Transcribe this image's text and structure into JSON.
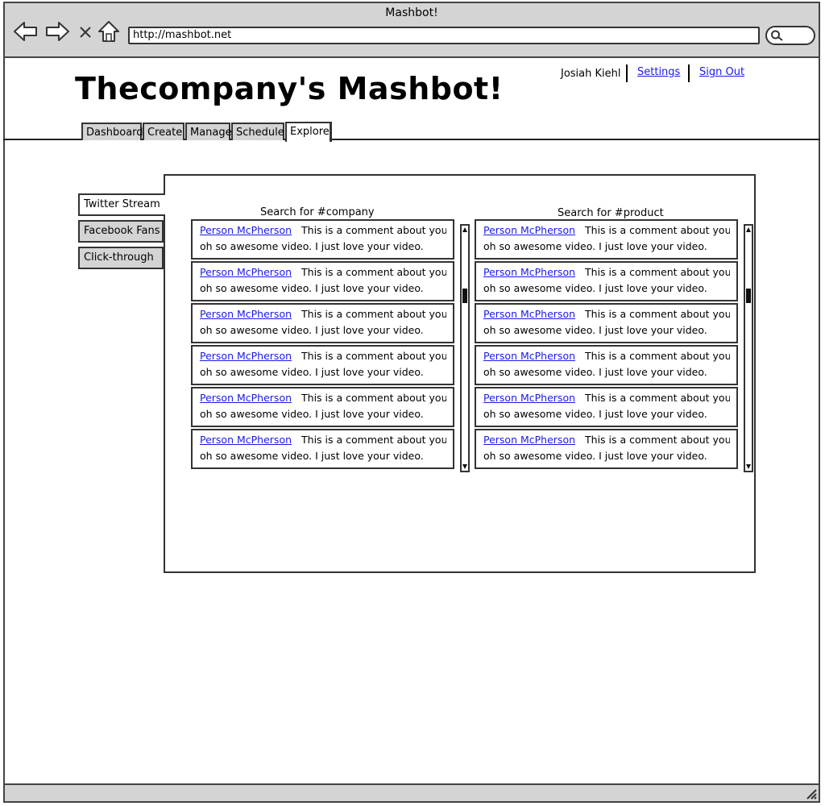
{
  "window": {
    "title": "Mashbot!"
  },
  "browser": {
    "url": "http://mashbot.net",
    "nav_icons": [
      "back-arrow-icon",
      "forward-arrow-icon",
      "close-icon",
      "home-icon",
      "search-icon"
    ]
  },
  "header": {
    "app_title": "Thecompany's Mashbot!",
    "user_name": "Josiah Kiehl",
    "settings_label": "Settings",
    "signout_label": "Sign Out"
  },
  "tabs": [
    {
      "label": "Dashboard",
      "active": false
    },
    {
      "label": "Create",
      "active": false
    },
    {
      "label": "Manage",
      "active": false
    },
    {
      "label": "Schedule",
      "active": false
    },
    {
      "label": "Explore",
      "active": true
    }
  ],
  "side_tabs": [
    {
      "label": "Twitter Stream",
      "active": true
    },
    {
      "label": "Facebook Fans",
      "active": false
    },
    {
      "label": "Click-through",
      "active": false
    }
  ],
  "columns": [
    {
      "title": "Search for #company",
      "items": [
        {
          "author": "Person McPherson",
          "text1": "This is a comment about your",
          "text2": "oh so awesome video.  I just love your video."
        },
        {
          "author": "Person McPherson",
          "text1": "This is a comment about your",
          "text2": "oh so awesome video.  I just love your video."
        },
        {
          "author": "Person McPherson",
          "text1": "This is a comment about your",
          "text2": "oh so awesome video.  I just love your video."
        },
        {
          "author": "Person McPherson",
          "text1": "This is a comment about your",
          "text2": "oh so awesome video.  I just love your video."
        },
        {
          "author": "Person McPherson",
          "text1": "This is a comment about your",
          "text2": "oh so awesome video.  I just love your video."
        },
        {
          "author": "Person McPherson",
          "text1": "This is a comment about your",
          "text2": "oh so awesome video.  I just love your video."
        }
      ]
    },
    {
      "title": "Search for #product",
      "items": [
        {
          "author": "Person McPherson",
          "text1": "This is a comment about your",
          "text2": "oh so awesome video.  I just love your video."
        },
        {
          "author": "Person McPherson",
          "text1": "This is a comment about your",
          "text2": "oh so awesome video.  I just love your video."
        },
        {
          "author": "Person McPherson",
          "text1": "This is a comment about your",
          "text2": "oh so awesome video.  I just love your video."
        },
        {
          "author": "Person McPherson",
          "text1": "This is a comment about your",
          "text2": "oh so awesome video.  I just love your video."
        },
        {
          "author": "Person McPherson",
          "text1": "This is a comment about your",
          "text2": "oh so awesome video.  I just love your video."
        },
        {
          "author": "Person McPherson",
          "text1": "This is a comment about your",
          "text2": "oh so awesome video.  I just love your video."
        }
      ]
    }
  ],
  "colors": {
    "chrome": "#d4d4d4",
    "link": "#1a1ae8",
    "border": "#333333"
  }
}
